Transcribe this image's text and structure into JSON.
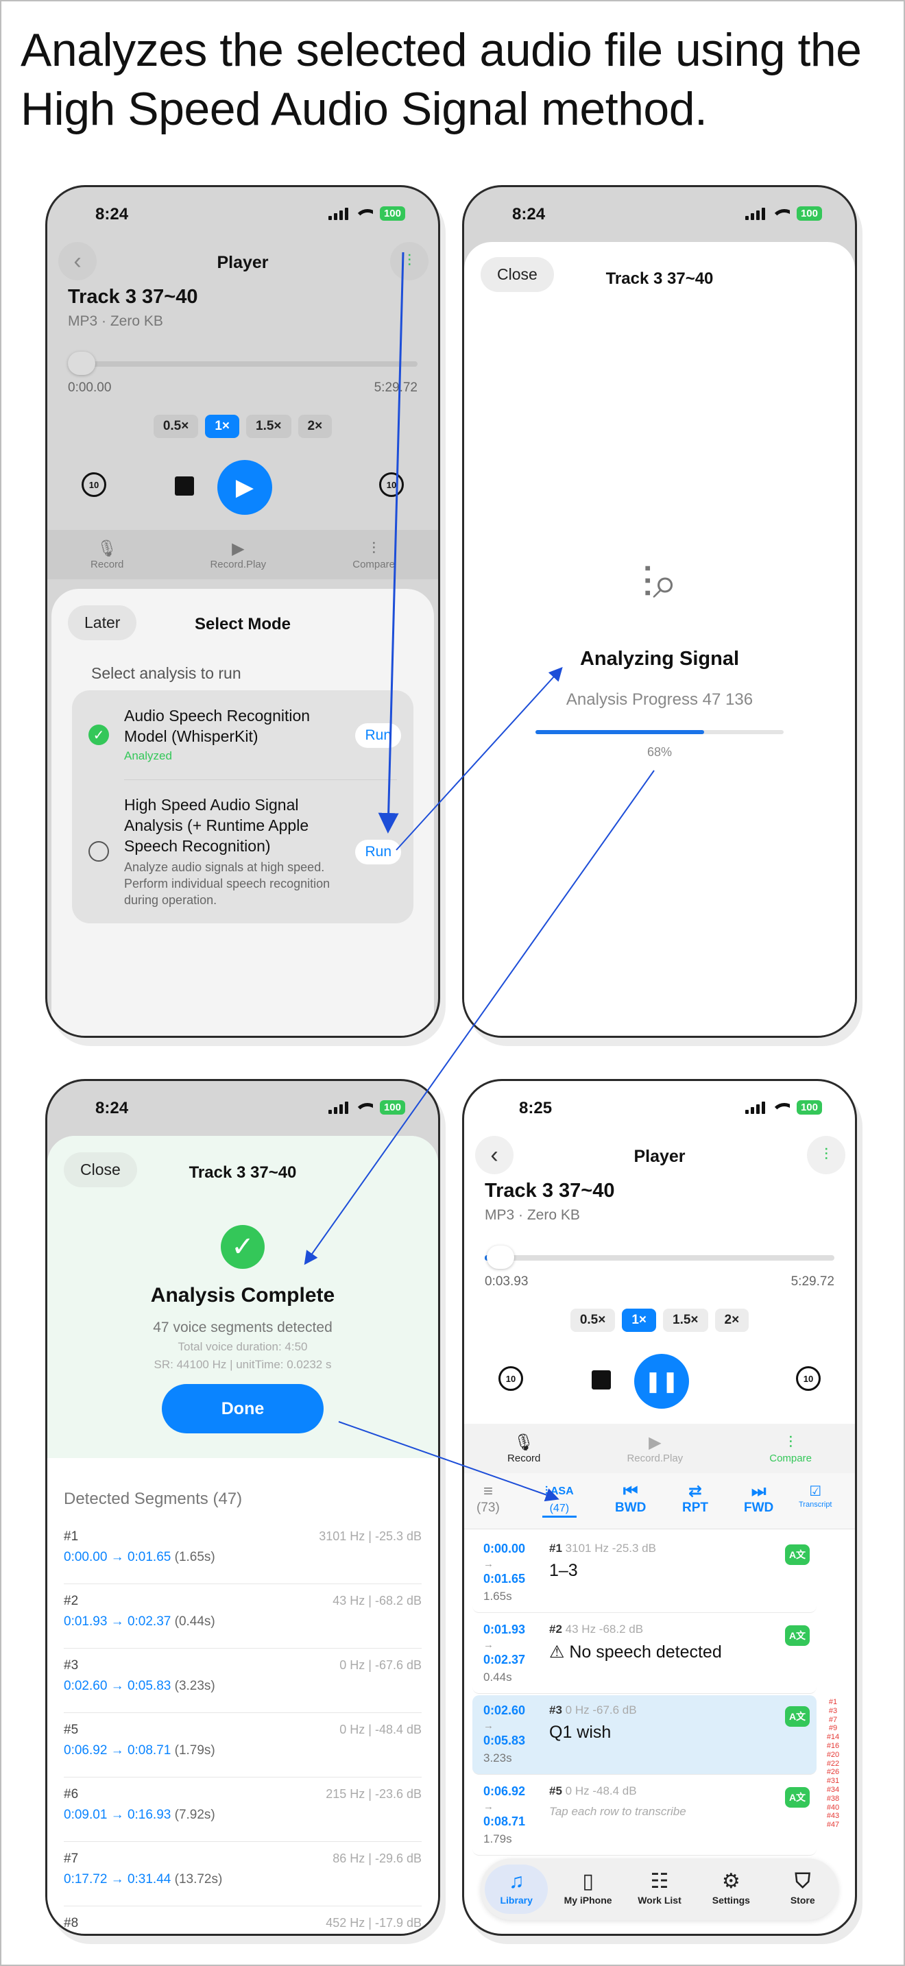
{
  "headline": "Analyzes the selected audio file using the High Speed Audio Signal method.",
  "colors": {
    "accent": "#0a84ff",
    "success": "#34c759",
    "arrow": "#1d4ed8"
  },
  "status": {
    "time": "8:24",
    "time_late": "8:25",
    "battery": "100"
  },
  "player": {
    "title": "Player",
    "track_title": "Track 3 37~40",
    "track_sub": "MP3 · Zero KB",
    "time_start": "0:00.00",
    "time_end": "5:29.72",
    "speeds": [
      "0.5×",
      "1×",
      "1.5×",
      "2×"
    ],
    "skip_label": "10",
    "tools": {
      "record": "Record",
      "record_play": "Record.Play",
      "compare": "Compare"
    }
  },
  "select_mode": {
    "later": "Later",
    "title": "Select Mode",
    "subtitle": "Select analysis to run",
    "option1": {
      "title": "Audio Speech Recognition Model (WhisperKit)",
      "status": "Analyzed",
      "run": "Run"
    },
    "option2": {
      "title": "High Speed Audio Signal Analysis (+ Runtime Apple Speech Recognition)",
      "desc": "Analyze audio signals at high speed. Perform individual speech recognition during operation.",
      "run": "Run"
    }
  },
  "analyzing": {
    "close": "Close",
    "title": "Track 3 37~40",
    "heading": "Analyzing Signal",
    "progress_label": "Analysis Progress  47 136",
    "percent": "68%",
    "progress_value": 0.68
  },
  "complete": {
    "close": "Close",
    "title": "Track 3 37~40",
    "heading": "Analysis Complete",
    "segments_detected": "47 voice segments detected",
    "total_duration": "Total voice duration: 4:50",
    "sr_info": "SR: 44100 Hz  |  unitTime: 0.0232 s",
    "done": "Done",
    "list_header": "Detected Segments (47)",
    "segments": [
      {
        "num": "#1",
        "meta": "3101 Hz  |  -25.3 dB",
        "range": "0:00.00 → 0:01.65",
        "dur": "(1.65s)"
      },
      {
        "num": "#2",
        "meta": "43 Hz  |  -68.2 dB",
        "range": "0:01.93 → 0:02.37",
        "dur": "(0.44s)"
      },
      {
        "num": "#3",
        "meta": "0 Hz  |  -67.6 dB",
        "range": "0:02.60 → 0:05.83",
        "dur": "(3.23s)"
      },
      {
        "num": "#5",
        "meta": "0 Hz  |  -48.4 dB",
        "range": "0:06.92 → 0:08.71",
        "dur": "(1.79s)"
      },
      {
        "num": "#6",
        "meta": "215 Hz  |  -23.6 dB",
        "range": "0:09.01 → 0:16.93",
        "dur": "(7.92s)"
      },
      {
        "num": "#7",
        "meta": "86 Hz  |  -29.6 dB",
        "range": "0:17.72 → 0:31.44",
        "dur": "(13.72s)"
      },
      {
        "num": "#8",
        "meta": "452 Hz  |  -17.9 dB",
        "range": "",
        "dur": ""
      }
    ]
  },
  "player2": {
    "time_now": "0:03.93",
    "progress_value": 0.014,
    "tabs": {
      "list_count": "(73)",
      "asa": "ASA",
      "asa_count": "(47)",
      "bwd": "BWD",
      "rpt": "RPT",
      "fwd": "FWD",
      "transcript": "Transcript"
    },
    "rows": [
      {
        "start": "0:00.00",
        "end": "0:01.65",
        "dur": "1.65s",
        "num": "#1",
        "meta": "3101 Hz  -25.3 dB",
        "text": "1–3",
        "hint": ""
      },
      {
        "start": "0:01.93",
        "end": "0:02.37",
        "dur": "0.44s",
        "num": "#2",
        "meta": "43 Hz  -68.2 dB",
        "text": "⚠ No speech detected",
        "hint": ""
      },
      {
        "start": "0:02.60",
        "end": "0:05.83",
        "dur": "3.23s",
        "num": "#3",
        "meta": "0 Hz  -67.6 dB",
        "text": "Q1 wish",
        "hint": ""
      },
      {
        "start": "0:06.92",
        "end": "0:08.71",
        "dur": "1.79s",
        "num": "#5",
        "meta": "0 Hz  -48.4 dB",
        "text": "",
        "hint": "Tap each row to transcribe"
      }
    ],
    "index": [
      "#1",
      "#3",
      "#7",
      "#9",
      "#14",
      "#16",
      "#20",
      "#22",
      "#26",
      "#31",
      "#34",
      "#38",
      "#40",
      "#43",
      "#47"
    ],
    "tabbar": [
      "Library",
      "My iPhone",
      "Work List",
      "Settings",
      "Store"
    ]
  }
}
